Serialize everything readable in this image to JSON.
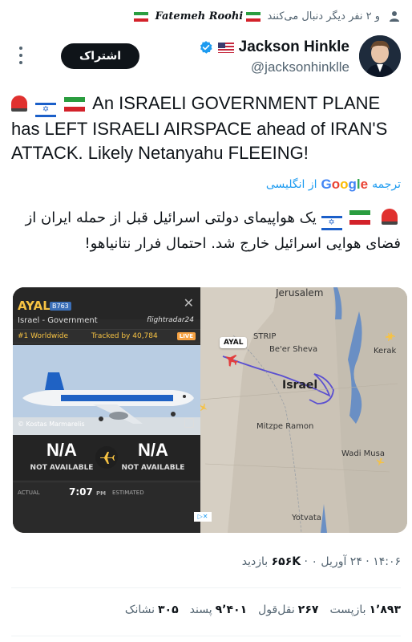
{
  "social_context": {
    "text": "و ۲ نفر دیگر دنبال می‌کنند",
    "name": "Fatemeh Roohi"
  },
  "author": {
    "name": "Jackson Hinkle",
    "handle": "@jacksonhinklle",
    "subscribe_label": "اشتراک"
  },
  "tweet": {
    "text": "An ISRAELI GOVERNMENT PLANE has LEFT ISRAELI AIRSPACE ahead of IRAN'S ATTACK. Likely Netanyahu FLEEING!",
    "translate_prefix": "ترجمه",
    "translate_google": "Google",
    "translate_suffix": "از انگلیسی",
    "translated_text": "یک هواپیمای دولتی اسرائیل قبل از حمله ایران از فضای هوایی اسرائیل خارج شد. احتمال فرار نتانیاهو!"
  },
  "flight_card": {
    "callsign": "AYAL",
    "aircraft_type": "B763",
    "operator": "Israel - Government",
    "logo": "flightradar24",
    "rank": "#1 Worldwide",
    "tracked": "Tracked by 40,784",
    "live_badge": "LIVE",
    "photo_credit": "© Kostas Marmarelis",
    "origin_code": "N/A",
    "origin_status": "NOT AVAILABLE",
    "destination_code": "N/A",
    "destination_status": "NOT AVAILABLE",
    "actual_label": "ACTUAL",
    "actual_time": "7:07",
    "actual_suffix": "PM",
    "estimated_label": "ESTIMATED"
  },
  "map": {
    "labels": {
      "jerusalem": "Jerusalem",
      "strip": "STRIP",
      "beer_sheva": "Be'er Sheva",
      "israel": "Israel",
      "mitzpe": "Mitzpe Ramon",
      "kerak": "Kerak",
      "wadi_musa": "Wadi Musa",
      "yotvata": "Yotvata"
    },
    "plane_tag": "AYAL"
  },
  "meta": {
    "time": "۱۴:۰۶",
    "date": "۲۴ آوریل ۰",
    "views": "۶۵۶K",
    "views_label": "بازدید"
  },
  "stats": {
    "reposts": "۱٬۸۹۳",
    "reposts_label": "بازپست",
    "quotes": "۲۶۷",
    "quotes_label": "نقل‌قول",
    "likes": "۹٬۴۰۱",
    "likes_label": "پسند",
    "bookmarks": "۳۰۵",
    "bookmarks_label": "نشانک"
  },
  "colors": {
    "verified": "#1d9bf0",
    "link": "#1d9bf0",
    "fr_accent": "#f6c243"
  }
}
